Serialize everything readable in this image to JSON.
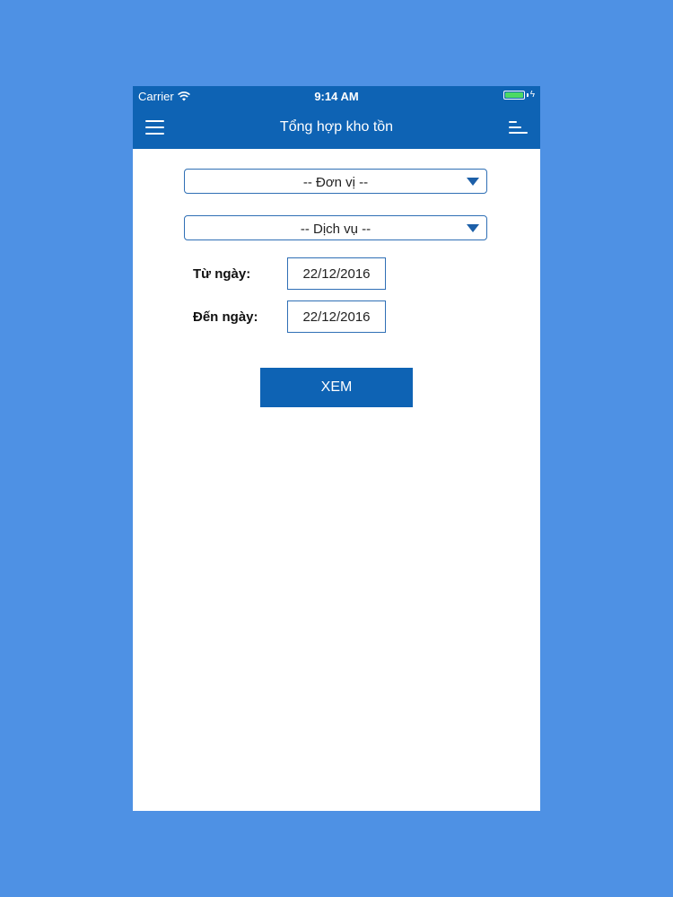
{
  "status_bar": {
    "carrier": "Carrier",
    "time": "9:14 AM",
    "battery_color": "#4cd964"
  },
  "nav_bar": {
    "title": "Tổng hợp kho tồn",
    "left_icon": "hamburger-menu-icon",
    "right_icon": "sort-icon",
    "background_color": "#0e63b4"
  },
  "form": {
    "unit_select": {
      "selected": "-- Đơn vị --"
    },
    "service_select": {
      "selected": "-- Dịch vụ --"
    },
    "from_date": {
      "label": "Từ ngày:",
      "value": "22/12/2016"
    },
    "to_date": {
      "label": "Đến ngày:",
      "value": "22/12/2016"
    },
    "submit_label": "XEM"
  },
  "colors": {
    "page_background": "#4e91e4",
    "accent": "#0e63b4",
    "border": "#2f6fb5"
  }
}
